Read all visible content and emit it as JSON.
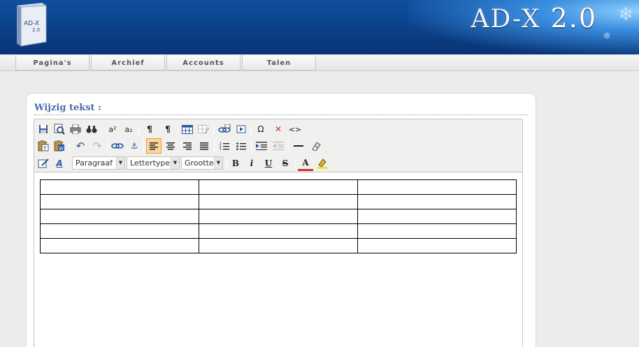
{
  "header": {
    "app_title": "AD-X",
    "app_version": "2.0",
    "box_label": "AD-X",
    "box_version": "2.0",
    "brand_color": "#0b3f86"
  },
  "nav": {
    "tabs": [
      {
        "label": "Pagina's"
      },
      {
        "label": "Archief"
      },
      {
        "label": "Accounts"
      },
      {
        "label": "Talen"
      }
    ]
  },
  "panel": {
    "title": "Wijzig tekst :"
  },
  "toolbar": {
    "row1": [
      "save-icon",
      "preview-icon",
      "print-icon",
      "find-icon",
      "superscript-icon",
      "subscript-icon",
      "ltr-icon",
      "rtl-icon",
      "table-icon",
      "table-props-icon",
      "link-icon",
      "media-icon",
      "special-char-icon",
      "remove-format-icon",
      "source-code-icon"
    ],
    "row2": [
      "paste-text-icon",
      "paste-word-icon",
      "undo-icon",
      "redo-icon",
      "link2-icon",
      "anchor-icon",
      "align-left-icon",
      "align-center-icon",
      "align-right-icon",
      "align-justify-icon",
      "ordered-list-icon",
      "unordered-list-icon",
      "indent-icon",
      "outdent-icon",
      "horizontal-rule-icon",
      "cleanup-icon"
    ],
    "row3": [
      "edit-style-icon",
      "font-style-icon",
      "bold-icon",
      "italic-icon",
      "underline-icon",
      "strikethrough-icon",
      "text-color-icon",
      "highlight-icon"
    ],
    "format_select": "Paragraaf",
    "font_select": "Lettertype",
    "size_select": "Grootte",
    "bold_label": "B",
    "italic_label": "i",
    "underline_label": "U",
    "strike_label": "S",
    "text_color_label": "A",
    "superscript_label": "a²",
    "subscript_label": "a₂",
    "omega_label": "Ω",
    "source_label": "<>"
  },
  "editor_table": {
    "rows": 5,
    "cols": 3
  }
}
